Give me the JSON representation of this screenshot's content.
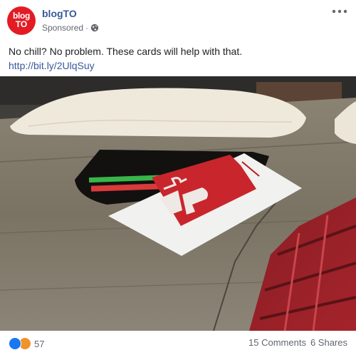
{
  "post": {
    "page_name": "blogTO",
    "avatar_line1": "blog",
    "avatar_line2": "TO",
    "sponsored": "Sponsored",
    "separator": "·",
    "text": "No chill? No problem. These cards will help with that.",
    "link": "http://bit.ly/2UlqSuy",
    "more_icon": "more-horizontal-icon",
    "privacy_icon": "globe-icon"
  },
  "footer": {
    "reaction_count": "57",
    "comments": "15 Comments",
    "shares": "6 Shares",
    "reactions": [
      "like",
      "angry"
    ]
  },
  "colors": {
    "brand": "#e31b23",
    "link": "#385898",
    "like": "#1877f2"
  }
}
